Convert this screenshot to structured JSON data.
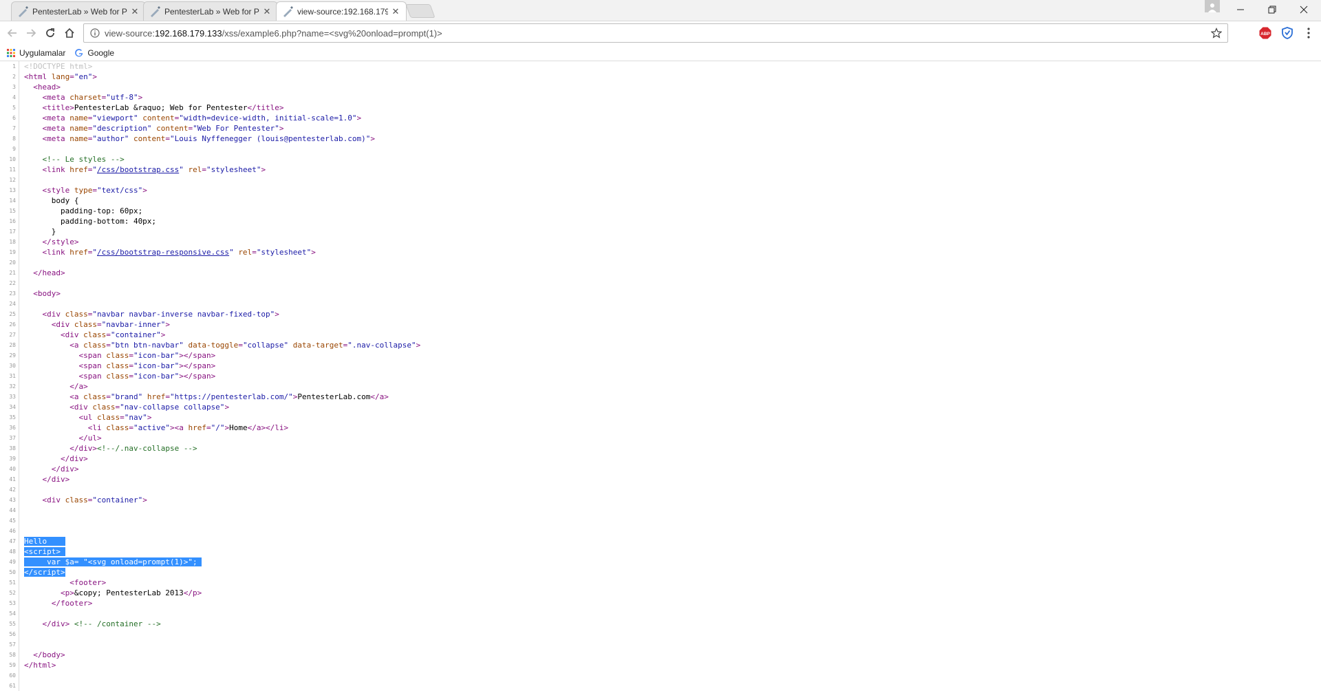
{
  "tabs": [
    {
      "title": "PentesterLab » Web for P",
      "active": false
    },
    {
      "title": "PentesterLab » Web for P",
      "active": false
    },
    {
      "title": "view-source:192.168.179.",
      "active": true
    }
  ],
  "address_bar": {
    "prefix": "view-source:",
    "host": "192.168.179.133",
    "path": "/xss/example6.php?name=<svg%20onload=prompt(1)>"
  },
  "bookmarks": [
    {
      "label": "Uygulamalar",
      "icon": "apps-grid-icon"
    },
    {
      "label": "Google",
      "icon": "google-g-icon"
    }
  ],
  "source_lines": [
    {
      "n": "1",
      "html": "<span class=\"dt\">&lt;!DOCTYPE html&gt;</span>"
    },
    {
      "n": "2",
      "html": "<span class=\"t\">&lt;html </span><span class=\"a\">lang</span><span class=\"t\">=</span><span class=\"v\">\"en\"</span><span class=\"t\">&gt;</span>"
    },
    {
      "n": "3",
      "html": "  <span class=\"t\">&lt;head&gt;</span>"
    },
    {
      "n": "4",
      "html": "    <span class=\"t\">&lt;meta </span><span class=\"a\">charset</span><span class=\"t\">=</span><span class=\"v\">\"utf-8\"</span><span class=\"t\">&gt;</span>"
    },
    {
      "n": "5",
      "html": "    <span class=\"t\">&lt;title&gt;</span>PentesterLab &amp;raquo; Web for Pentester<span class=\"t\">&lt;/title&gt;</span>"
    },
    {
      "n": "6",
      "html": "    <span class=\"t\">&lt;meta </span><span class=\"a\">name</span><span class=\"t\">=</span><span class=\"v\">\"viewport\"</span><span class=\"t\"> </span><span class=\"a\">content</span><span class=\"t\">=</span><span class=\"v\">\"width=device-width, initial-scale=1.0\"</span><span class=\"t\">&gt;</span>"
    },
    {
      "n": "7",
      "html": "    <span class=\"t\">&lt;meta </span><span class=\"a\">name</span><span class=\"t\">=</span><span class=\"v\">\"description\"</span><span class=\"t\"> </span><span class=\"a\">content</span><span class=\"t\">=</span><span class=\"v\">\"Web For Pentester\"</span><span class=\"t\">&gt;</span>"
    },
    {
      "n": "8",
      "html": "    <span class=\"t\">&lt;meta </span><span class=\"a\">name</span><span class=\"t\">=</span><span class=\"v\">\"author\"</span><span class=\"t\"> </span><span class=\"a\">content</span><span class=\"t\">=</span><span class=\"v\">\"Louis Nyffenegger (louis@pentesterlab.com)\"</span><span class=\"t\">&gt;</span>"
    },
    {
      "n": "9",
      "html": ""
    },
    {
      "n": "10",
      "html": "    <span class=\"c\">&lt;!-- Le styles --&gt;</span>"
    },
    {
      "n": "11",
      "html": "    <span class=\"t\">&lt;link </span><span class=\"a\">href</span><span class=\"t\">=</span><span class=\"v\">\"</span><span class=\"lk\">/css/bootstrap.css</span><span class=\"v\">\"</span><span class=\"t\"> </span><span class=\"a\">rel</span><span class=\"t\">=</span><span class=\"v\">\"stylesheet\"</span><span class=\"t\">&gt;</span>"
    },
    {
      "n": "12",
      "html": ""
    },
    {
      "n": "13",
      "html": "    <span class=\"t\">&lt;style </span><span class=\"a\">type</span><span class=\"t\">=</span><span class=\"v\">\"text/css\"</span><span class=\"t\">&gt;</span>"
    },
    {
      "n": "14",
      "html": "      body {"
    },
    {
      "n": "15",
      "html": "        padding-top: 60px;"
    },
    {
      "n": "16",
      "html": "        padding-bottom: 40px;"
    },
    {
      "n": "17",
      "html": "      }"
    },
    {
      "n": "18",
      "html": "    <span class=\"t\">&lt;/style&gt;</span>"
    },
    {
      "n": "19",
      "html": "    <span class=\"t\">&lt;link </span><span class=\"a\">href</span><span class=\"t\">=</span><span class=\"v\">\"</span><span class=\"lk\">/css/bootstrap-responsive.css</span><span class=\"v\">\"</span><span class=\"t\"> </span><span class=\"a\">rel</span><span class=\"t\">=</span><span class=\"v\">\"stylesheet\"</span><span class=\"t\">&gt;</span>"
    },
    {
      "n": "20",
      "html": ""
    },
    {
      "n": "21",
      "html": "  <span class=\"t\">&lt;/head&gt;</span>"
    },
    {
      "n": "22",
      "html": ""
    },
    {
      "n": "23",
      "html": "  <span class=\"t\">&lt;body&gt;</span>"
    },
    {
      "n": "24",
      "html": ""
    },
    {
      "n": "25",
      "html": "    <span class=\"t\">&lt;div </span><span class=\"a\">class</span><span class=\"t\">=</span><span class=\"v\">\"navbar navbar-inverse navbar-fixed-top\"</span><span class=\"t\">&gt;</span>"
    },
    {
      "n": "26",
      "html": "      <span class=\"t\">&lt;div </span><span class=\"a\">class</span><span class=\"t\">=</span><span class=\"v\">\"navbar-inner\"</span><span class=\"t\">&gt;</span>"
    },
    {
      "n": "27",
      "html": "        <span class=\"t\">&lt;div </span><span class=\"a\">class</span><span class=\"t\">=</span><span class=\"v\">\"container\"</span><span class=\"t\">&gt;</span>"
    },
    {
      "n": "28",
      "html": "          <span class=\"t\">&lt;a </span><span class=\"a\">class</span><span class=\"t\">=</span><span class=\"v\">\"btn btn-navbar\"</span><span class=\"t\"> </span><span class=\"a\">data-toggle</span><span class=\"t\">=</span><span class=\"v\">\"collapse\"</span><span class=\"t\"> </span><span class=\"a\">data-target</span><span class=\"t\">=</span><span class=\"v\">\".nav-collapse\"</span><span class=\"t\">&gt;</span>"
    },
    {
      "n": "29",
      "html": "            <span class=\"t\">&lt;span </span><span class=\"a\">class</span><span class=\"t\">=</span><span class=\"v\">\"icon-bar\"</span><span class=\"t\">&gt;&lt;/span&gt;</span>"
    },
    {
      "n": "30",
      "html": "            <span class=\"t\">&lt;span </span><span class=\"a\">class</span><span class=\"t\">=</span><span class=\"v\">\"icon-bar\"</span><span class=\"t\">&gt;&lt;/span&gt;</span>"
    },
    {
      "n": "31",
      "html": "            <span class=\"t\">&lt;span </span><span class=\"a\">class</span><span class=\"t\">=</span><span class=\"v\">\"icon-bar\"</span><span class=\"t\">&gt;&lt;/span&gt;</span>"
    },
    {
      "n": "32",
      "html": "          <span class=\"t\">&lt;/a&gt;</span>"
    },
    {
      "n": "33",
      "html": "          <span class=\"t\">&lt;a </span><span class=\"a\">class</span><span class=\"t\">=</span><span class=\"v\">\"brand\"</span><span class=\"t\"> </span><span class=\"a\">href</span><span class=\"t\">=</span><span class=\"v\">\"https://pentesterlab.com/\"</span><span class=\"t\">&gt;</span>PentesterLab.com<span class=\"t\">&lt;/a&gt;</span>"
    },
    {
      "n": "34",
      "html": "          <span class=\"t\">&lt;div </span><span class=\"a\">class</span><span class=\"t\">=</span><span class=\"v\">\"nav-collapse collapse\"</span><span class=\"t\">&gt;</span>"
    },
    {
      "n": "35",
      "html": "            <span class=\"t\">&lt;ul </span><span class=\"a\">class</span><span class=\"t\">=</span><span class=\"v\">\"nav\"</span><span class=\"t\">&gt;</span>"
    },
    {
      "n": "36",
      "html": "              <span class=\"t\">&lt;li </span><span class=\"a\">class</span><span class=\"t\">=</span><span class=\"v\">\"active\"</span><span class=\"t\">&gt;&lt;a </span><span class=\"a\">href</span><span class=\"t\">=</span><span class=\"v\">\"/\"</span><span class=\"t\">&gt;</span>Home<span class=\"t\">&lt;/a&gt;&lt;/li&gt;</span>"
    },
    {
      "n": "37",
      "html": "            <span class=\"t\">&lt;/ul&gt;</span>"
    },
    {
      "n": "38",
      "html": "          <span class=\"t\">&lt;/div&gt;</span><span class=\"c\">&lt;!--/.nav-collapse --&gt;</span>"
    },
    {
      "n": "39",
      "html": "        <span class=\"t\">&lt;/div&gt;</span>"
    },
    {
      "n": "40",
      "html": "      <span class=\"t\">&lt;/div&gt;</span>"
    },
    {
      "n": "41",
      "html": "    <span class=\"t\">&lt;/div&gt;</span>"
    },
    {
      "n": "42",
      "html": ""
    },
    {
      "n": "43",
      "html": "    <span class=\"t\">&lt;div </span><span class=\"a\">class</span><span class=\"t\">=</span><span class=\"v\">\"container\"</span><span class=\"t\">&gt;</span>"
    },
    {
      "n": "44",
      "html": ""
    },
    {
      "n": "45",
      "html": ""
    },
    {
      "n": "46",
      "html": ""
    },
    {
      "n": "47",
      "html": "<span class=\"sel\">Hello    </span>"
    },
    {
      "n": "48",
      "html": "<span class=\"sel\">&lt;script&gt; </span>"
    },
    {
      "n": "49",
      "html": "<span class=\"sel\">     var $a= \"&lt;svg onload=prompt(1)&gt;\"; </span>"
    },
    {
      "n": "50",
      "html": "<span class=\"sel\">&lt;/script&gt;</span>"
    },
    {
      "n": "51",
      "html": "          <span class=\"t\">&lt;footer&gt;</span>"
    },
    {
      "n": "52",
      "html": "        <span class=\"t\">&lt;p&gt;</span>&amp;copy; PentesterLab 2013<span class=\"t\">&lt;/p&gt;</span>"
    },
    {
      "n": "53",
      "html": "      <span class=\"t\">&lt;/footer&gt;</span>"
    },
    {
      "n": "54",
      "html": ""
    },
    {
      "n": "55",
      "html": "    <span class=\"t\">&lt;/div&gt;</span> <span class=\"c\">&lt;!-- /container --&gt;</span>"
    },
    {
      "n": "56",
      "html": ""
    },
    {
      "n": "57",
      "html": ""
    },
    {
      "n": "58",
      "html": "  <span class=\"t\">&lt;/body&gt;</span>"
    },
    {
      "n": "59",
      "html": "<span class=\"t\">&lt;/html&gt;</span>"
    },
    {
      "n": "60",
      "html": ""
    },
    {
      "n": "61",
      "html": ""
    }
  ],
  "colors": {
    "selection": "#3390ff",
    "tag": "#881280",
    "attribute": "#994500",
    "value": "#1a1aa6",
    "comment": "#236e25"
  }
}
